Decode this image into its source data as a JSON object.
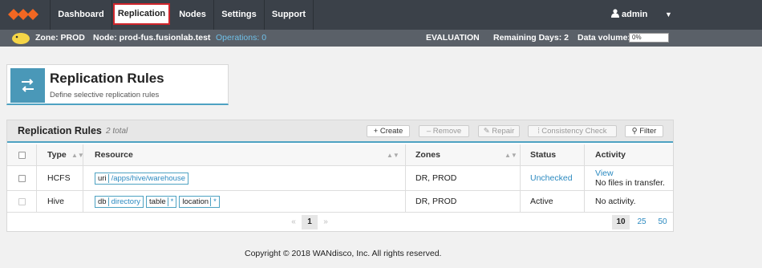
{
  "nav": {
    "items": [
      "Dashboard",
      "Replication",
      "Nodes",
      "Settings",
      "Support"
    ],
    "user": "admin"
  },
  "status": {
    "zone": "Zone: PROD",
    "node": "Node: prod-fus.fusionlab.test",
    "operations": "Operations: 0",
    "evaluation": "EVALUATION",
    "remaining": "Remaining Days: 2",
    "volume_label": "Data volume:",
    "volume_value": "0%"
  },
  "header": {
    "title": "Replication Rules",
    "subtitle": "Define selective replication rules"
  },
  "panel": {
    "title": "Replication Rules",
    "count": "2 total",
    "buttons": [
      "+ Create",
      "– Remove",
      "Repair",
      "Consistency Check",
      "Filter"
    ]
  },
  "table": {
    "headers": [
      "Type",
      "Resource",
      "Zones",
      "Status",
      "Activity"
    ],
    "rows": [
      {
        "type": "HCFS",
        "resource_key": "uri",
        "resource_value": "/apps/hive/warehouse",
        "zones": "DR, PROD",
        "status": "Unchecked",
        "activity_link": "View",
        "activity": "No files in transfer."
      },
      {
        "type": "Hive",
        "db_key": "db",
        "db_value": "directory",
        "table_key": "table",
        "table_value": "*",
        "location_key": "location",
        "location_value": "*",
        "zones": "DR, PROD",
        "status": "Active",
        "activity": "No activity."
      }
    ]
  },
  "pager": {
    "prev": "«",
    "page": "1",
    "next": "»",
    "sizes": [
      "10",
      "25",
      "50"
    ]
  },
  "footer": "Copyright © 2018 WANdisco, Inc. All rights reserved.",
  "colors": {
    "accent": "#4ea2c2",
    "topbar": "#3b4149",
    "logo": "#f26722",
    "highlight": "#d0252b"
  }
}
